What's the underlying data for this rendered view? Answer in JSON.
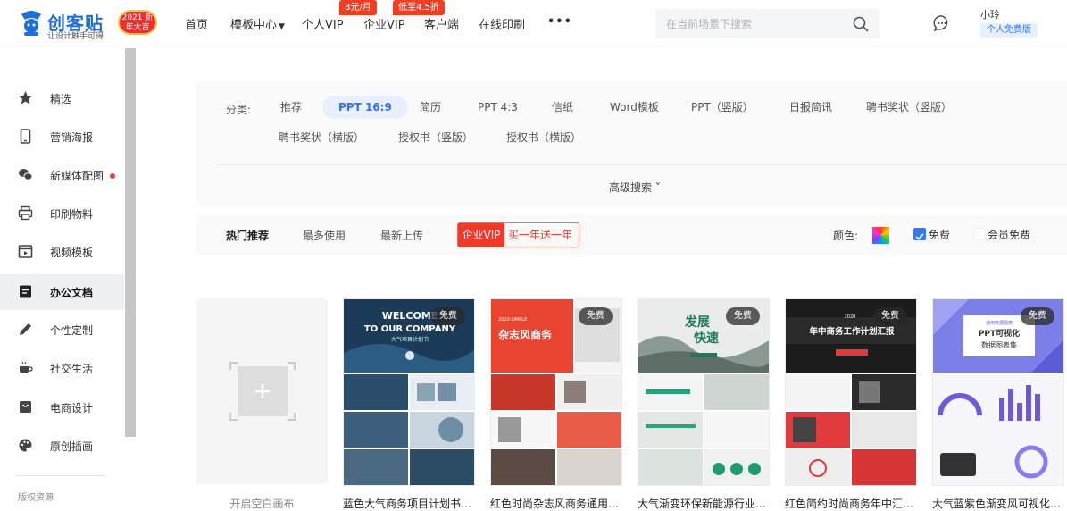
{
  "brand": {
    "name": "创客贴",
    "slogan": "让设计触手可得",
    "badge": "2021 新年大吉",
    "colors": {
      "primary": "#1e6fd9",
      "accent": "#f23d23"
    }
  },
  "nav": {
    "items": [
      {
        "label": "首页"
      },
      {
        "label": "模板中心"
      },
      {
        "label": "个人VIP",
        "tag": "8元/月"
      },
      {
        "label": "企业VIP",
        "tag": "低至4.5折"
      },
      {
        "label": "客户端"
      },
      {
        "label": "在线印刷"
      },
      {
        "label": "•••"
      }
    ]
  },
  "search": {
    "placeholder": "在当前场景下搜索"
  },
  "user": {
    "name": "小玲",
    "badge": "个人免费版"
  },
  "sidebar": {
    "items": [
      {
        "label": "精选",
        "icon": "star-icon"
      },
      {
        "label": "营销海报",
        "icon": "phone-icon"
      },
      {
        "label": "新媒体配图",
        "icon": "wechat-icon"
      },
      {
        "label": "印刷物料",
        "icon": "printer-icon"
      },
      {
        "label": "视频模板",
        "icon": "video-icon"
      },
      {
        "label": "办公文档",
        "icon": "document-icon"
      },
      {
        "label": "个性定制",
        "icon": "pencil-icon"
      },
      {
        "label": "社交生活",
        "icon": "coffee-icon"
      },
      {
        "label": "电商设计",
        "icon": "shop-icon"
      },
      {
        "label": "原创插画",
        "icon": "palette-icon"
      }
    ],
    "active": "办公文档",
    "footer": "版权资源"
  },
  "filter": {
    "label": "分类:",
    "categories": [
      "推荐",
      "PPT 16:9",
      "简历",
      "PPT 4:3",
      "信纸",
      "Word模板",
      "PPT（竖版）",
      "日报简讯",
      "聘书奖状（竖版）",
      "聘书奖状（横版）",
      "授权书（竖版）",
      "授权书（横版）"
    ],
    "active": "PPT 16:9",
    "advanced": "高级搜索 ˅"
  },
  "sort": {
    "tabs": [
      "热门推荐",
      "最多使用",
      "最新上传"
    ],
    "active": "热门推荐",
    "vip_label": "企业VIP",
    "vip_promo": "买一年送一年",
    "color_label": "颜色:",
    "free_label": "免费",
    "member_free_label": "会员免费",
    "free_checked": true,
    "member_free_checked": false
  },
  "blank": {
    "label": "开启空白画布"
  },
  "templates": [
    {
      "title": "蓝色大气商务项目计划书PPT",
      "badge": "免费",
      "cover": "WELCOME TO OUR COMPANY",
      "cover_sub": "大气项目计划书"
    },
    {
      "title": "红色时尚杂志风商务通用PPT",
      "badge": "免费",
      "cover": "杂志风商务",
      "cover_sub": "2020 SIMPLE"
    },
    {
      "title": "大气渐变环保新能源行业PPT",
      "badge": "免费",
      "cover": "发展快速",
      "cover_sub": ""
    },
    {
      "title": "红色简约时尚商务年中汇报PPT",
      "badge": "免费",
      "cover": "年中商务工作计划汇报",
      "cover_sub": "2020"
    },
    {
      "title": "大气蓝紫色渐变风可视化PPT",
      "badge": "免费",
      "cover": "PPT可视化 数据图表集",
      "cover_sub": "通用数据图表"
    }
  ]
}
